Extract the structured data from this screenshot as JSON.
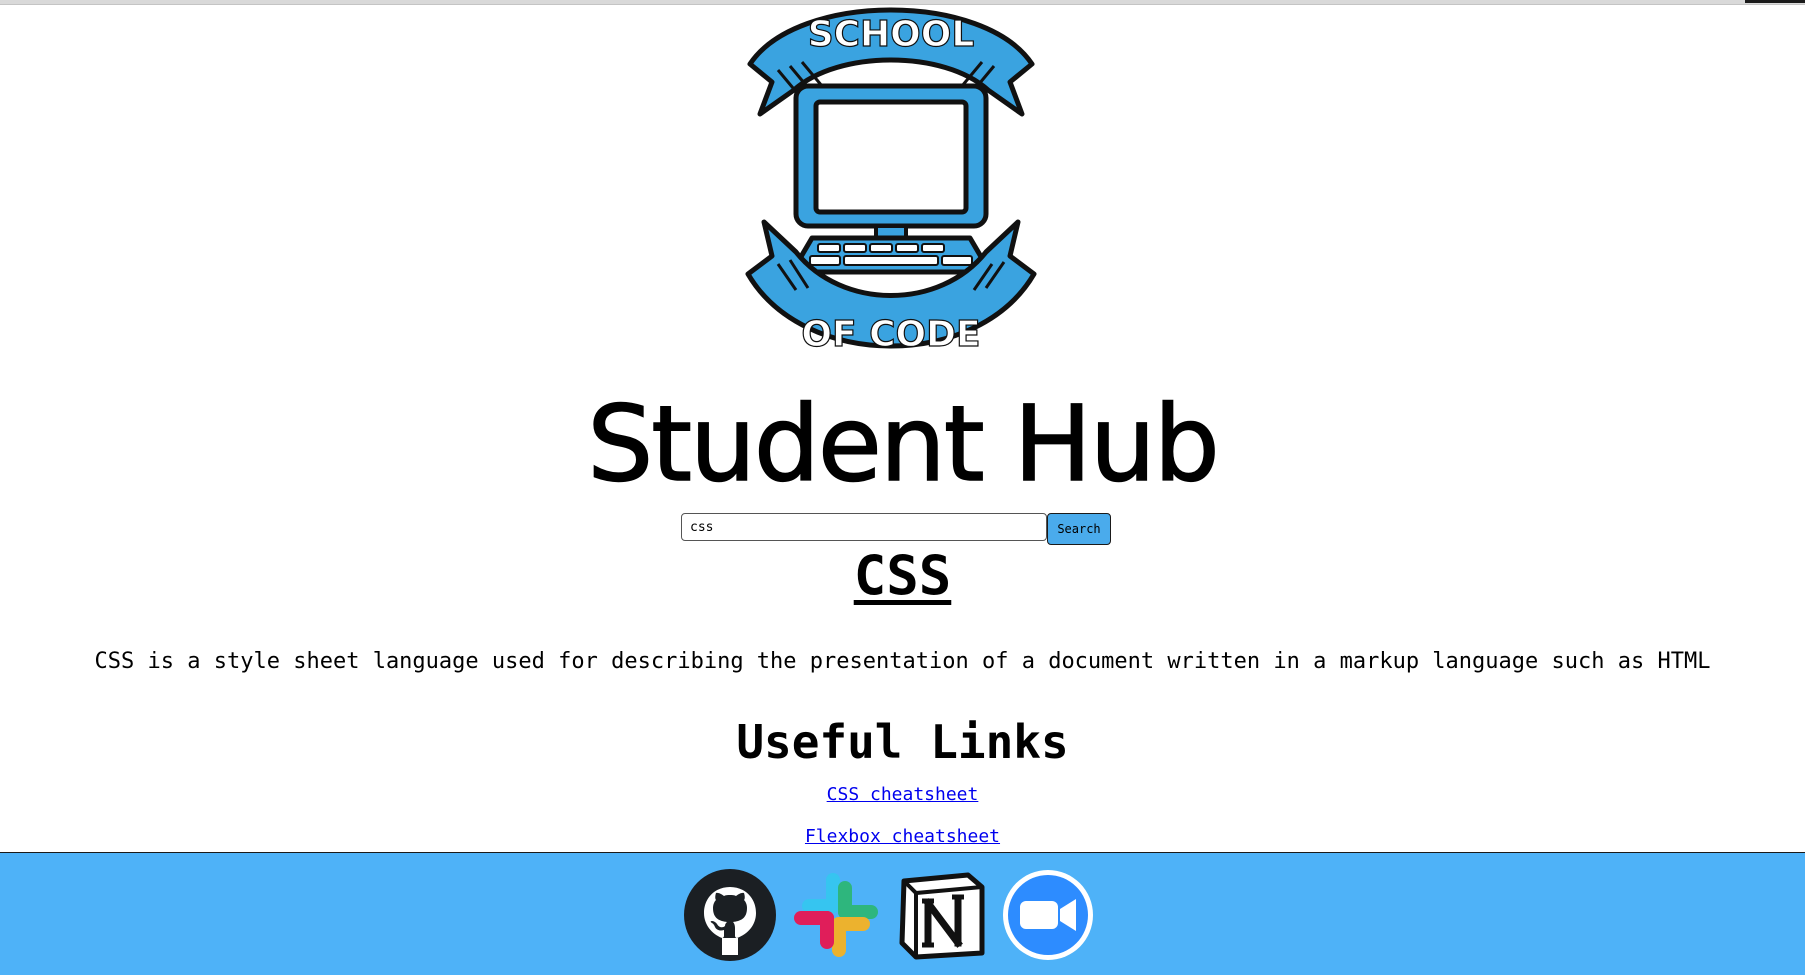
{
  "logo": {
    "top_text": "SCHOOL",
    "bottom_text": "OF CODE",
    "colors": {
      "blue": "#3aa3e0",
      "dark": "#111111"
    }
  },
  "header": {
    "title": "Student Hub"
  },
  "search": {
    "value": "css",
    "button_label": "Search"
  },
  "topic": {
    "heading": "CSS",
    "description": "CSS is a style sheet language used for describing the presentation of a document written in a markup language such as HTML"
  },
  "links": {
    "heading": "Useful Links",
    "items": [
      {
        "label": "CSS cheatsheet"
      },
      {
        "label": "Flexbox cheatsheet"
      }
    ]
  },
  "footer": {
    "background": "#4eb2f8",
    "icons": [
      {
        "name": "github-icon"
      },
      {
        "name": "slack-icon"
      },
      {
        "name": "notion-icon"
      },
      {
        "name": "zoom-icon"
      }
    ]
  }
}
